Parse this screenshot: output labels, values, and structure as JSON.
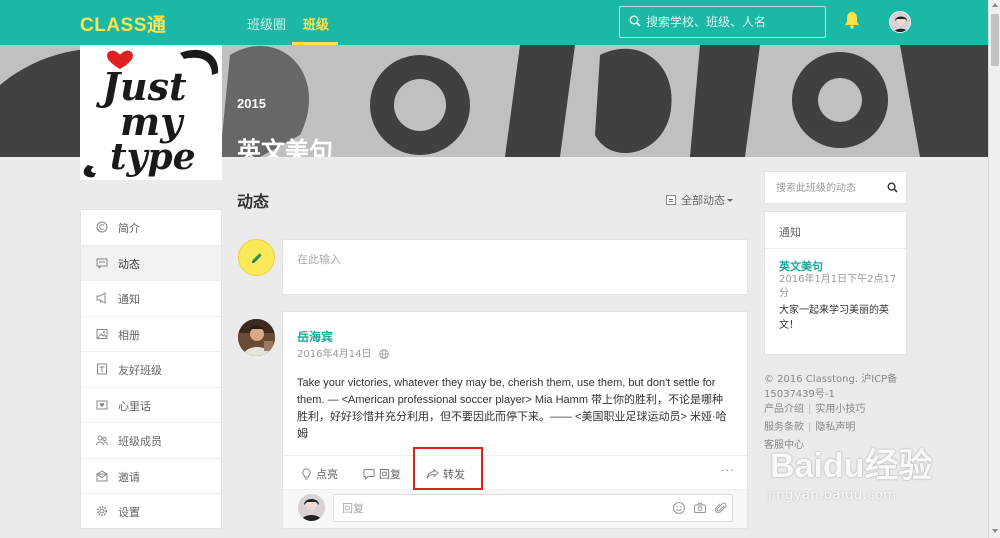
{
  "header": {
    "logo": "CLASS通",
    "nav": [
      {
        "label": "班级圈",
        "active": false
      },
      {
        "label": "班级",
        "active": true
      }
    ],
    "search_placeholder": "搜索学校、班级、人名"
  },
  "banner": {
    "year": "2015",
    "title": "英文美句",
    "logo_text": [
      "Just",
      "my",
      "type"
    ]
  },
  "sidebar": {
    "items": [
      {
        "label": "简介",
        "icon": "copyright-icon",
        "active": false
      },
      {
        "label": "动态",
        "icon": "feed-icon",
        "active": true
      },
      {
        "label": "通知",
        "icon": "megaphone-icon",
        "active": false
      },
      {
        "label": "相册",
        "icon": "photo-icon",
        "active": false
      },
      {
        "label": "友好班级",
        "icon": "friends-class-icon",
        "active": false
      },
      {
        "label": "心里话",
        "icon": "heart-message-icon",
        "active": false
      },
      {
        "label": "班级成员",
        "icon": "members-icon",
        "active": false
      },
      {
        "label": "邀请",
        "icon": "invite-icon",
        "active": false
      },
      {
        "label": "设置",
        "icon": "gear-icon",
        "active": false
      }
    ]
  },
  "feed": {
    "title": "动态",
    "filter_label": "全部动态",
    "compose_placeholder": "在此输入",
    "post": {
      "author": "岳海宾",
      "date": "2016年4月14日",
      "text": "Take your victories, whatever they may be, cherish them, use them, but don't settle for them. — <American professional soccer player> Mia Hamm 带上你的胜利，不论是哪种胜利，好好珍惜并充分利用，但不要因此而停下来。—— <美国职业足球运动员> 米娅·哈姆",
      "actions": {
        "like": "点亮",
        "reply": "回复",
        "share": "转发",
        "more": "···"
      },
      "reply_placeholder": "回复"
    }
  },
  "right": {
    "search_placeholder": "搜索此班级的动态",
    "notice": {
      "header": "通知",
      "title": "英文美句",
      "date": "2016年1月1日下午2点17分",
      "body": "大家一起来学习美丽的英文！"
    },
    "footer": {
      "copyright": "© 2016 Classtong. 沪ICP备15037439号-1",
      "links": [
        "产品介绍",
        "实用小技巧",
        "服务条款",
        "隐私声明",
        "客服中心"
      ]
    }
  },
  "watermark": {
    "main": "Baidu经验",
    "sub": "jingyan.baidu.com"
  },
  "colors": {
    "teal": "#1bb8a6",
    "yellow": "#ffe24d",
    "highlight_red": "#d9241c",
    "author_green": "#1ba99a"
  }
}
